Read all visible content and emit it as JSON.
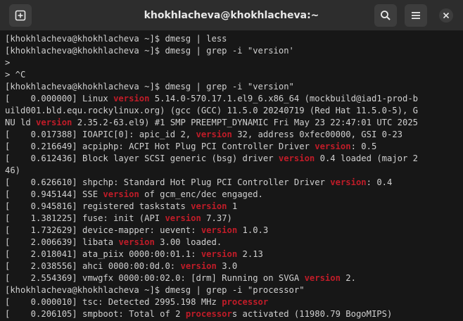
{
  "window": {
    "title": "khokhlacheva@khokhlacheva:~",
    "icons": {
      "new_tab": "new-tab-icon",
      "search": "search-icon",
      "menu": "hamburger-menu-icon",
      "close": "close-icon"
    }
  },
  "colors": {
    "background": "#171717",
    "text": "#d0d0d0",
    "highlight": "#c01c28",
    "titlebar": "#2d2d2d"
  },
  "terminal": {
    "lines": [
      [
        {
          "t": "[khokhlacheva@khokhlacheva ~]$ dmesg | less"
        }
      ],
      [
        {
          "t": "[khokhlacheva@khokhlacheva ~]$ dmesg | grep -i \"version'"
        }
      ],
      [
        {
          "t": ">"
        }
      ],
      [
        {
          "t": "> ^C"
        }
      ],
      [
        {
          "t": "[khokhlacheva@khokhlacheva ~]$ dmesg | grep -i \"version\""
        }
      ],
      [
        {
          "t": "[    0.000000] Linux "
        },
        {
          "t": "version",
          "h": true
        },
        {
          "t": " 5.14.0-570.17.1.el9_6.x86_64 (mockbuild@iad1-prod-b"
        }
      ],
      [
        {
          "t": "uild001.bld.equ.rockylinux.org) (gcc (GCC) 11.5.0 20240719 (Red Hat 11.5.0-5), G"
        }
      ],
      [
        {
          "t": "NU ld "
        },
        {
          "t": "version",
          "h": true
        },
        {
          "t": " 2.35.2-63.el9) #1 SMP PREEMPT_DYNAMIC Fri May 23 22:47:01 UTC 2025"
        }
      ],
      [
        {
          "t": "[    0.017388] IOAPIC[0]: apic_id 2, "
        },
        {
          "t": "version",
          "h": true
        },
        {
          "t": " 32, address 0xfec00000, GSI 0-23"
        }
      ],
      [
        {
          "t": "[    0.216649] acpiphp: ACPI Hot Plug PCI Controller Driver "
        },
        {
          "t": "version",
          "h": true
        },
        {
          "t": ": 0.5"
        }
      ],
      [
        {
          "t": "[    0.612436] Block layer SCSI generic (bsg) driver "
        },
        {
          "t": "version",
          "h": true
        },
        {
          "t": " 0.4 loaded (major 2"
        }
      ],
      [
        {
          "t": "46)"
        }
      ],
      [
        {
          "t": "[    0.626610] shpchp: Standard Hot Plug PCI Controller Driver "
        },
        {
          "t": "version",
          "h": true
        },
        {
          "t": ": 0.4"
        }
      ],
      [
        {
          "t": "[    0.945144] SSE "
        },
        {
          "t": "version",
          "h": true
        },
        {
          "t": " of gcm_enc/dec engaged."
        }
      ],
      [
        {
          "t": "[    0.945816] registered taskstats "
        },
        {
          "t": "version",
          "h": true
        },
        {
          "t": " 1"
        }
      ],
      [
        {
          "t": "[    1.381225] fuse: init (API "
        },
        {
          "t": "version",
          "h": true
        },
        {
          "t": " 7.37)"
        }
      ],
      [
        {
          "t": "[    1.732629] device-mapper: uevent: "
        },
        {
          "t": "version",
          "h": true
        },
        {
          "t": " 1.0.3"
        }
      ],
      [
        {
          "t": "[    2.006639] libata "
        },
        {
          "t": "version",
          "h": true
        },
        {
          "t": " 3.00 loaded."
        }
      ],
      [
        {
          "t": "[    2.018041] ata_piix 0000:00:01.1: "
        },
        {
          "t": "version",
          "h": true
        },
        {
          "t": " 2.13"
        }
      ],
      [
        {
          "t": "[    2.038556] ahci 0000:00:0d.0: "
        },
        {
          "t": "version",
          "h": true
        },
        {
          "t": " 3.0"
        }
      ],
      [
        {
          "t": "[    2.554369] vmwgfx 0000:00:02.0: [drm] Running on SVGA "
        },
        {
          "t": "version",
          "h": true
        },
        {
          "t": " 2."
        }
      ],
      [
        {
          "t": "[khokhlacheva@khokhlacheva ~]$ dmesg | grep -i \"processor\""
        }
      ],
      [
        {
          "t": "[    0.000010] tsc: Detected 2995.198 MHz "
        },
        {
          "t": "processor",
          "h": true
        }
      ],
      [
        {
          "t": "[    0.206105] smpboot: Total of 2 "
        },
        {
          "t": "processor",
          "h": true
        },
        {
          "t": "s activated (11980.79 BogoMIPS)"
        }
      ]
    ]
  }
}
